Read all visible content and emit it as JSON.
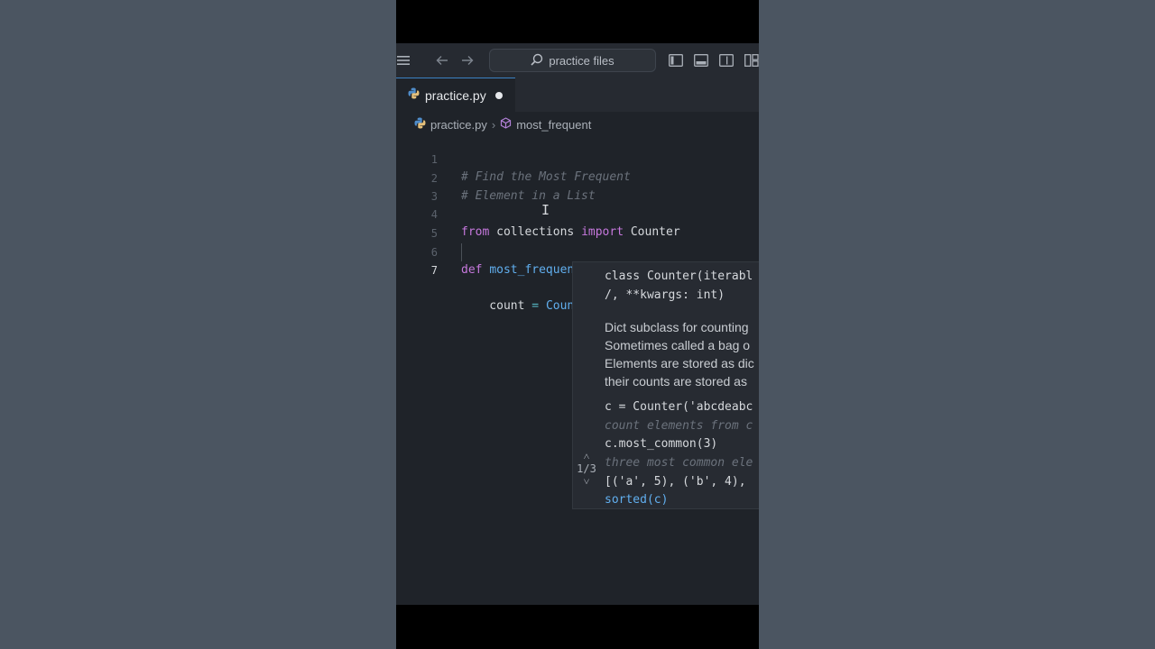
{
  "titlebar": {
    "search_text": "practice files"
  },
  "tab": {
    "label": "practice.py"
  },
  "breadcrumb": {
    "file": "practice.py",
    "symbol": "most_frequent"
  },
  "code_lines": [
    {
      "num": "1",
      "text": "# Find the Most Frequent"
    },
    {
      "num": "2",
      "text": "# Element in a List"
    },
    {
      "num": "3",
      "text": ""
    },
    {
      "num": "4",
      "text": "from collections import Counter"
    },
    {
      "num": "5",
      "text": ""
    },
    {
      "num": "6",
      "text": "def most_frequent(lst):"
    },
    {
      "num": "7",
      "text": "    count = Counter()"
    }
  ],
  "hover": {
    "sig_line1": "class Counter(iterabl",
    "sig_line2": "/, **kwargs: int)",
    "doc1": "Dict subclass for counting",
    "doc2": "Sometimes called a bag o",
    "doc3": "Elements are stored as dic",
    "doc4": "their counts are stored as",
    "ex1": "c = Counter('abcdeabc",
    "ex2": "count elements from c",
    "ex3": "c.most_common(3)",
    "ex4": "three most common ele",
    "ex5": "[('a', 5), ('b', 4),",
    "ex6": "sorted(c)",
    "nav": "1/3"
  }
}
